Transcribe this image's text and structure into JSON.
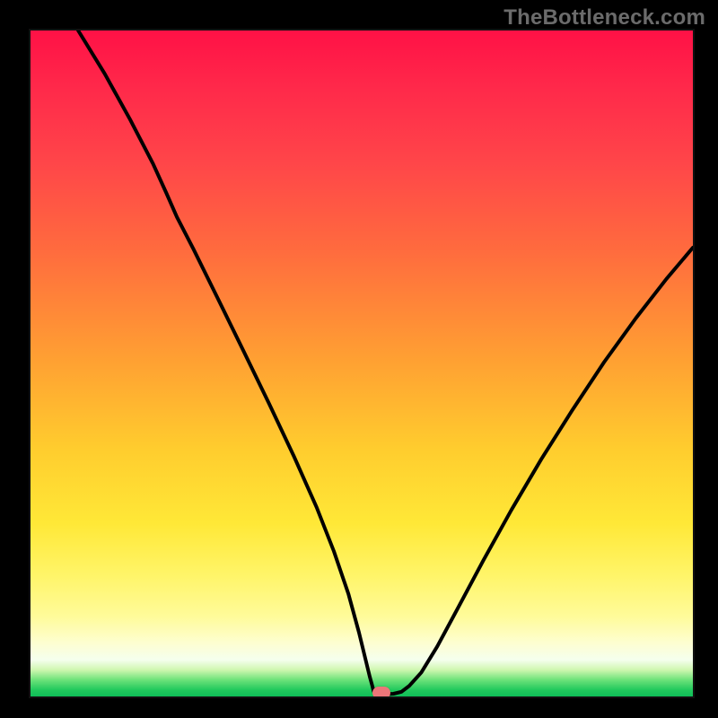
{
  "watermark": {
    "text": "TheBottleneck.com"
  },
  "marker": {
    "semantic": "optimal-point-marker",
    "x_norm": 0.53,
    "y_norm": 0.995,
    "color": "#ec7679"
  },
  "gradient": {
    "stops_semantic": "performance-heatmap-vertical",
    "top": "#ff1146",
    "bottom": "#0fbe58"
  },
  "curve": {
    "semantic": "bottleneck-curve",
    "points_norm": [
      [
        0.072,
        0.0
      ],
      [
        0.112,
        0.065
      ],
      [
        0.15,
        0.133
      ],
      [
        0.185,
        0.2
      ],
      [
        0.205,
        0.244
      ],
      [
        0.221,
        0.28
      ],
      [
        0.246,
        0.328
      ],
      [
        0.283,
        0.403
      ],
      [
        0.322,
        0.482
      ],
      [
        0.36,
        0.56
      ],
      [
        0.398,
        0.64
      ],
      [
        0.432,
        0.716
      ],
      [
        0.458,
        0.782
      ],
      [
        0.48,
        0.846
      ],
      [
        0.496,
        0.904
      ],
      [
        0.506,
        0.945
      ],
      [
        0.512,
        0.97
      ],
      [
        0.516,
        0.984
      ],
      [
        0.518,
        0.992
      ],
      [
        0.52,
        0.996
      ],
      [
        0.53,
        0.997
      ],
      [
        0.548,
        0.996
      ],
      [
        0.56,
        0.993
      ],
      [
        0.572,
        0.984
      ],
      [
        0.59,
        0.964
      ],
      [
        0.614,
        0.925
      ],
      [
        0.646,
        0.866
      ],
      [
        0.684,
        0.795
      ],
      [
        0.726,
        0.72
      ],
      [
        0.771,
        0.644
      ],
      [
        0.818,
        0.57
      ],
      [
        0.866,
        0.498
      ],
      [
        0.914,
        0.432
      ],
      [
        0.96,
        0.373
      ],
      [
        1.0,
        0.326
      ]
    ]
  },
  "chart_data": {
    "type": "line",
    "title": "",
    "xlabel": "",
    "ylabel": "",
    "xlim": [
      0,
      1
    ],
    "ylim": [
      0,
      1
    ],
    "series": [
      {
        "name": "bottleneck-curve",
        "x": [
          0.072,
          0.112,
          0.15,
          0.185,
          0.205,
          0.221,
          0.246,
          0.283,
          0.322,
          0.36,
          0.398,
          0.432,
          0.458,
          0.48,
          0.496,
          0.506,
          0.512,
          0.516,
          0.518,
          0.52,
          0.53,
          0.548,
          0.56,
          0.572,
          0.59,
          0.614,
          0.646,
          0.684,
          0.726,
          0.771,
          0.818,
          0.866,
          0.914,
          0.96,
          1.0
        ],
        "y": [
          1.0,
          0.935,
          0.867,
          0.8,
          0.756,
          0.72,
          0.672,
          0.597,
          0.518,
          0.44,
          0.36,
          0.284,
          0.218,
          0.154,
          0.096,
          0.055,
          0.03,
          0.016,
          0.008,
          0.004,
          0.003,
          0.004,
          0.007,
          0.016,
          0.036,
          0.075,
          0.134,
          0.205,
          0.28,
          0.356,
          0.43,
          0.502,
          0.568,
          0.627,
          0.674
        ]
      }
    ],
    "annotations": [
      {
        "name": "optimal-point",
        "x": 0.53,
        "y": 0.0
      }
    ],
    "background": "vertical-heatmap-red-to-green"
  }
}
